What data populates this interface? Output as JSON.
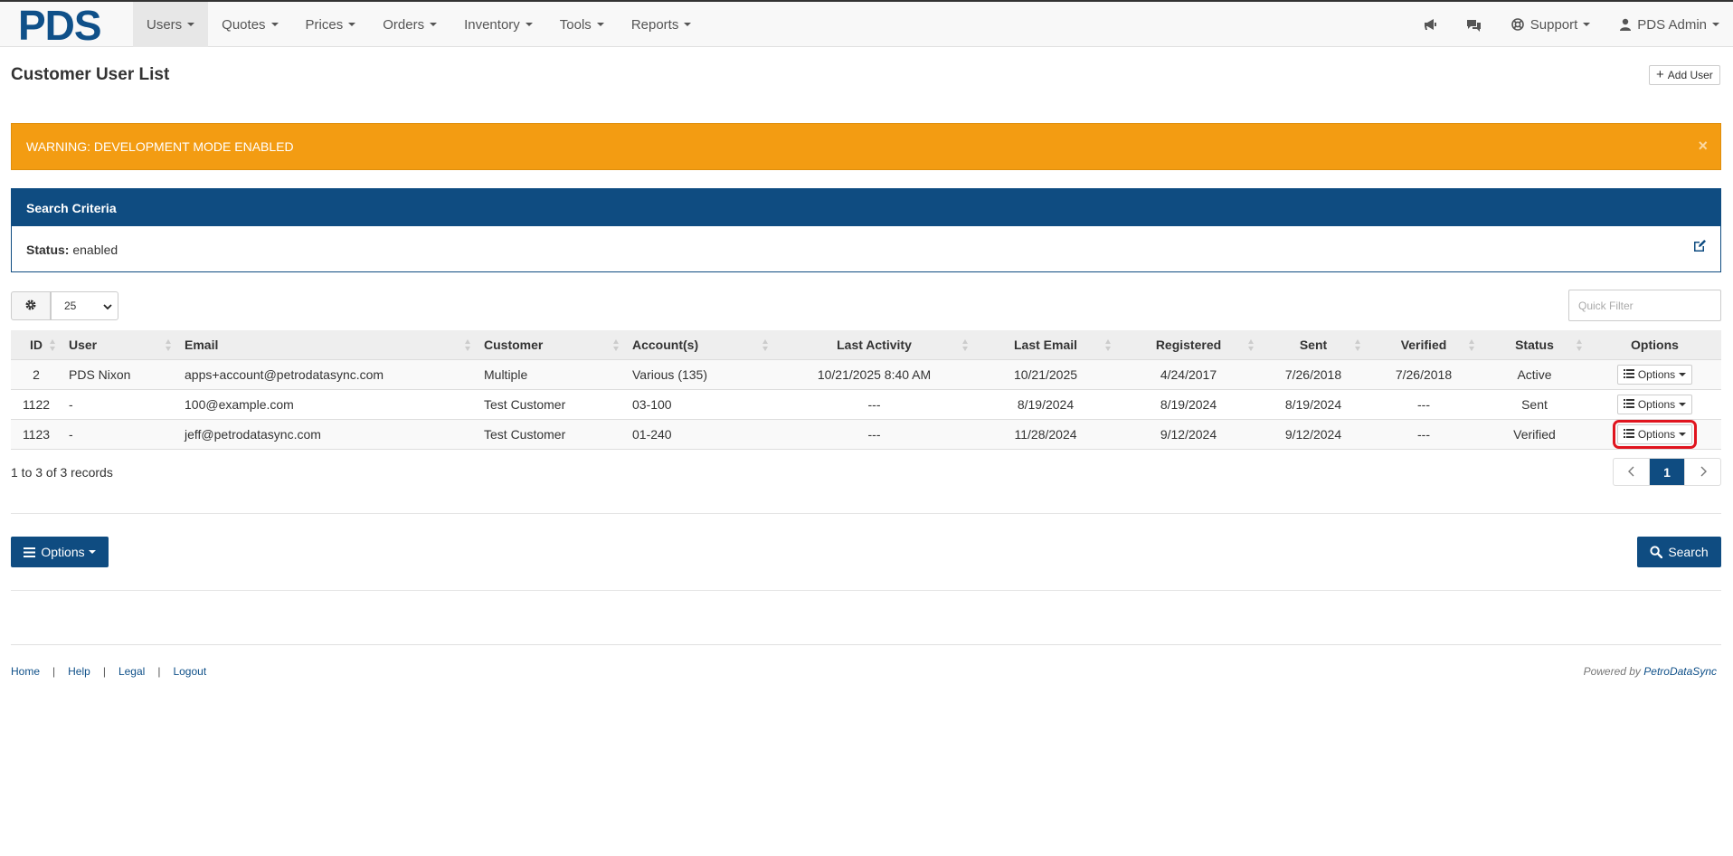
{
  "brand": "PDS",
  "nav": {
    "items": [
      {
        "label": "Users",
        "active": true
      },
      {
        "label": "Quotes"
      },
      {
        "label": "Prices"
      },
      {
        "label": "Orders"
      },
      {
        "label": "Inventory"
      },
      {
        "label": "Tools"
      },
      {
        "label": "Reports"
      }
    ],
    "support_label": "Support",
    "user_label": "PDS Admin"
  },
  "page": {
    "title": "Customer User List",
    "add_user_label": "Add User"
  },
  "alert": {
    "text": "WARNING: DEVELOPMENT MODE ENABLED",
    "close": "×",
    "color": "#f39c12"
  },
  "search_criteria": {
    "heading": "Search Criteria",
    "status_label": "Status:",
    "status_value": "enabled"
  },
  "table_controls": {
    "page_size": "25",
    "quick_filter_placeholder": "Quick Filter"
  },
  "table": {
    "headers": [
      "ID",
      "User",
      "Email",
      "Customer",
      "Account(s)",
      "Last Activity",
      "Last Email",
      "Registered",
      "Sent",
      "Verified",
      "Status",
      "Options"
    ],
    "rows": [
      {
        "id": "2",
        "user": "PDS Nixon",
        "email": "apps+account@petrodatasync.com",
        "customer": "Multiple",
        "accounts": "Various (135)",
        "last_activity": "10/21/2025 8:40 AM",
        "last_email": "10/21/2025",
        "registered": "4/24/2017",
        "sent": "7/26/2018",
        "verified": "7/26/2018",
        "status": "Active",
        "options": "Options"
      },
      {
        "id": "1122",
        "user": "-",
        "email": "100@example.com",
        "customer": "Test Customer",
        "accounts": "03-100",
        "last_activity": "---",
        "last_email": "8/19/2024",
        "registered": "8/19/2024",
        "sent": "8/19/2024",
        "verified": "---",
        "status": "Sent",
        "options": "Options"
      },
      {
        "id": "1123",
        "user": "-",
        "email": "jeff@petrodatasync.com",
        "customer": "Test Customer",
        "accounts": "01-240",
        "last_activity": "---",
        "last_email": "11/28/2024",
        "registered": "9/12/2024",
        "sent": "9/12/2024",
        "verified": "---",
        "status": "Verified",
        "options": "Options"
      }
    ]
  },
  "records_info": "1 to 3 of 3 records",
  "pager": {
    "current": "1"
  },
  "actions": {
    "options_label": "Options",
    "search_label": "Search"
  },
  "footer": {
    "links": [
      "Home",
      "Help",
      "Legal",
      "Logout"
    ],
    "powered_prefix": "Powered by",
    "powered_brand": "PetroDataSync"
  },
  "colors": {
    "primary": "#0f4c81",
    "warning": "#f39c12",
    "highlight": "#e0141e"
  }
}
